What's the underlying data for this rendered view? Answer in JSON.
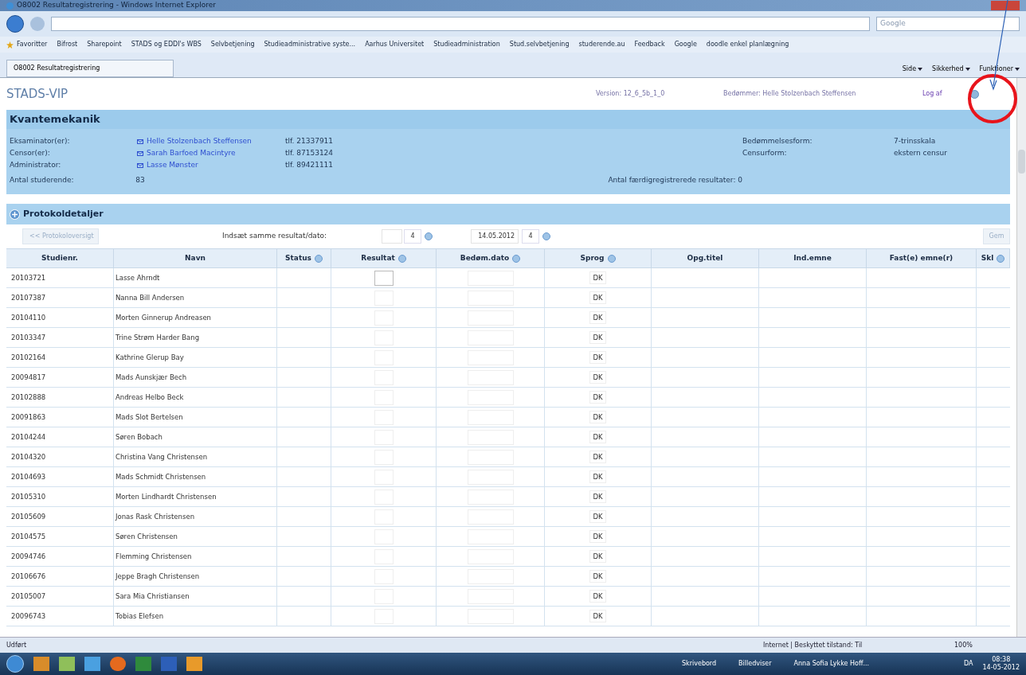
{
  "window": {
    "title": "O8002 Resultatregistrering - Windows Internet Explorer",
    "search_placeholder": "Google"
  },
  "favorites": {
    "label": "Favoritter",
    "links": [
      "Bifrost",
      "Sharepoint",
      "STADS og EDDI's WBS",
      "Selvbetjening",
      "Studieadministrative syste...",
      "Aarhus Universitet",
      "Studieadministration",
      "Stud.selvbetjening",
      "studerende.au",
      "Feedback",
      "Google",
      "doodle enkel planlægning"
    ]
  },
  "tab": {
    "label": "O8002 Resultatregistrering"
  },
  "commands": [
    "Side",
    "Sikkerhed",
    "Funktioner"
  ],
  "header": {
    "logo": "STADS-VIP",
    "version": "Version: 12_6_5b_1_0",
    "assessor": "Bedømmer: Helle Stolzenbach Steffensen",
    "logout": "Log af"
  },
  "course": {
    "title": "Kvantemekanik",
    "people": [
      {
        "role": "Eksaminator(er):",
        "name": "Helle Stolzenbach Steffensen",
        "phone": "tlf. 21337911"
      },
      {
        "role": "Censor(er):",
        "name": "Sarah Barfoed Macintyre",
        "phone": "tlf. 87153124"
      },
      {
        "role": "Administrator:",
        "name": "Lasse Mønster",
        "phone": "tlf. 89421111"
      }
    ],
    "students_label": "Antal studerende:",
    "students_value": "83",
    "finished_label": "Antal færdigregistrerede resultater: 0",
    "facts": [
      {
        "label": "Bedømmelsesform:",
        "value": "7-trinsskala"
      },
      {
        "label": "Censurform:",
        "value": "ekstern censur"
      }
    ]
  },
  "details": {
    "title": "Protokoldetaljer",
    "back_button": "<< Protokoloversigt",
    "same_label": "Indsæt samme resultat/dato:",
    "select_1": "4",
    "date": "14.05.2012",
    "select_2": "4",
    "save_button": "Gem"
  },
  "table": {
    "columns": [
      {
        "label": "Studienr.",
        "info": false
      },
      {
        "label": "Navn",
        "info": false
      },
      {
        "label": "Status",
        "info": true
      },
      {
        "label": "Resultat",
        "info": true
      },
      {
        "label": "Bedøm.dato",
        "info": true
      },
      {
        "label": "Sprog",
        "info": true
      },
      {
        "label": "Opg.titel",
        "info": false
      },
      {
        "label": "Ind.emne",
        "info": false
      },
      {
        "label": "Fast(e) emne(r)",
        "info": false
      },
      {
        "label": "Skl",
        "info": true
      }
    ],
    "rows": [
      {
        "id": "20103721",
        "name": "Lasse Ahrndt",
        "lang": "DK"
      },
      {
        "id": "20107387",
        "name": "Nanna Bill Andersen",
        "lang": "DK"
      },
      {
        "id": "20104110",
        "name": "Morten Ginnerup Andreasen",
        "lang": "DK"
      },
      {
        "id": "20103347",
        "name": "Trine Strøm Harder Bang",
        "lang": "DK"
      },
      {
        "id": "20102164",
        "name": "Kathrine Glerup Bay",
        "lang": "DK"
      },
      {
        "id": "20094817",
        "name": "Mads Aunskjær Bech",
        "lang": "DK"
      },
      {
        "id": "20102888",
        "name": "Andreas Helbo Beck",
        "lang": "DK"
      },
      {
        "id": "20091863",
        "name": "Mads Slot Bertelsen",
        "lang": "DK"
      },
      {
        "id": "20104244",
        "name": "Søren Bobach",
        "lang": "DK"
      },
      {
        "id": "20104320",
        "name": "Christina Vang Christensen",
        "lang": "DK"
      },
      {
        "id": "20104693",
        "name": "Mads Schmidt Christensen",
        "lang": "DK"
      },
      {
        "id": "20105310",
        "name": "Morten Lindhardt Christensen",
        "lang": "DK"
      },
      {
        "id": "20105609",
        "name": "Jonas Rask Christensen",
        "lang": "DK"
      },
      {
        "id": "20104575",
        "name": "Søren Christensen",
        "lang": "DK"
      },
      {
        "id": "20094746",
        "name": "Flemming Christensen",
        "lang": "DK"
      },
      {
        "id": "20106676",
        "name": "Jeppe Bragh Christensen",
        "lang": "DK"
      },
      {
        "id": "20105007",
        "name": "Sara Mia Christiansen",
        "lang": "DK"
      },
      {
        "id": "20096743",
        "name": "Tobias Elefsen",
        "lang": "DK"
      }
    ]
  },
  "status_bar": {
    "text": "Udført",
    "zone": "Internet | Beskyttet tilstand: Til",
    "zoom": "100%"
  },
  "taskbar": {
    "items": [
      "Skrivebord",
      "Billedviser",
      "Anna Sofia Lykke Hoff..."
    ],
    "lang": "DA",
    "time": "08:38",
    "date": "14-05-2012"
  }
}
